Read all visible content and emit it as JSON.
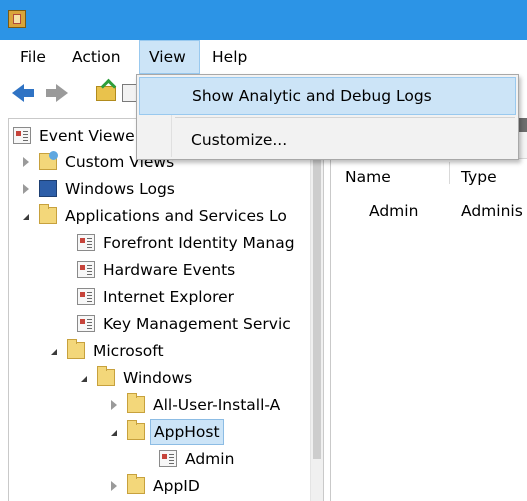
{
  "menubar": {
    "items": [
      "File",
      "Action",
      "View",
      "Help"
    ],
    "active": "View"
  },
  "view_menu": {
    "items": [
      "Show Analytic and Debug Logs",
      "Customize..."
    ],
    "highlighted": "Show Analytic and Debug Logs"
  },
  "tree": {
    "nodes": [
      {
        "label": "Event Viewe",
        "icon": "event-viewer-icon",
        "expander": "none"
      },
      {
        "label": "Custom Views",
        "icon": "custom-views-icon",
        "expander": "collapsed"
      },
      {
        "label": "Windows Logs",
        "icon": "windows-logs-icon",
        "expander": "collapsed"
      },
      {
        "label": "Applications and Services Lo",
        "icon": "folder-icon",
        "expander": "expanded"
      },
      {
        "label": "Forefront Identity Manag",
        "icon": "log-icon",
        "expander": "none"
      },
      {
        "label": "Hardware Events",
        "icon": "log-icon",
        "expander": "none"
      },
      {
        "label": "Internet Explorer",
        "icon": "log-icon",
        "expander": "none"
      },
      {
        "label": "Key Management Servic",
        "icon": "log-icon",
        "expander": "none"
      },
      {
        "label": "Microsoft",
        "icon": "folder-icon",
        "expander": "expanded"
      },
      {
        "label": "Windows",
        "icon": "folder-icon",
        "expander": "expanded"
      },
      {
        "label": "All-User-Install-A",
        "icon": "folder-icon",
        "expander": "collapsed"
      },
      {
        "label": "AppHost",
        "icon": "folder-icon",
        "expander": "expanded",
        "selected": true
      },
      {
        "label": "Admin",
        "icon": "log-icon",
        "expander": "none"
      },
      {
        "label": "AppID",
        "icon": "folder-icon",
        "expander": "collapsed"
      }
    ]
  },
  "list": {
    "columns": [
      "Name",
      "Type"
    ],
    "rows": [
      [
        "Admin",
        "Adminis"
      ]
    ]
  },
  "colors": {
    "titlebar": "#2c94e6",
    "selection": "#cce4f7",
    "menu_bg": "#f2f2f2"
  }
}
